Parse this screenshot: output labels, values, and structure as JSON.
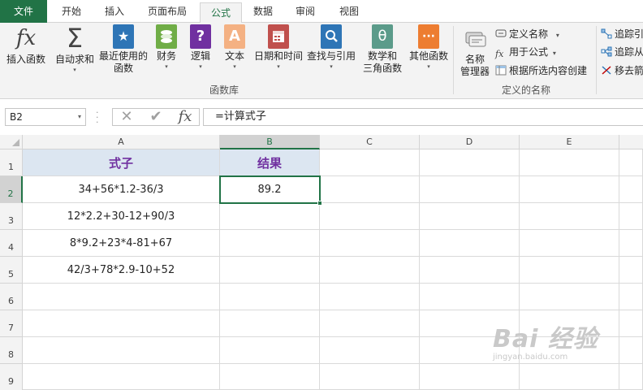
{
  "tabs": [
    "文件",
    "开始",
    "插入",
    "页面布局",
    "公式",
    "数据",
    "审阅",
    "视图"
  ],
  "active_tab": "公式",
  "ribbon": {
    "insert_function": "插入函数",
    "autosum": "自动求和",
    "recent_line1": "最近使用的",
    "recent_line2": "函数",
    "financial": "财务",
    "logical": "逻辑",
    "text": "文本",
    "datetime": "日期和时间",
    "lookup": "查找与引用",
    "math_line1": "数学和",
    "math_line2": "三角函数",
    "more": "其他函数",
    "function_library": "函数库",
    "name_manager_line1": "名称",
    "name_manager_line2": "管理器",
    "define_name": "定义名称",
    "use_in_formula": "用于公式",
    "create_from_selection": "根据所选内容创建",
    "defined_names": "定义的名称",
    "trace_precedents": "追踪引",
    "trace_dependents": "追踪从",
    "remove_arrows": "移去箭"
  },
  "icons": {
    "fx": "fx",
    "sigma": "Σ",
    "star": "★",
    "question": "?",
    "letter_a": "A",
    "theta": "θ",
    "more_dots": "···",
    "cancel": "✕",
    "confirm": "✔",
    "dropdown": "▾"
  },
  "colors": {
    "accent": "#217346",
    "header_fill": "#dce6f1",
    "header_text": "#7030a0"
  },
  "formula_bar": {
    "name_box": "B2",
    "formula": "=计算式子"
  },
  "columns": [
    "A",
    "B",
    "C",
    "D",
    "E"
  ],
  "rows": [
    "1",
    "2",
    "3",
    "4",
    "5",
    "6",
    "7",
    "8",
    "9"
  ],
  "cells": {
    "A1": "式子",
    "B1": "结果",
    "A2": "34+56*1.2-36/3",
    "B2": "89.2",
    "A3": "12*2.2+30-12+90/3",
    "A4": "8*9.2+23*4-81+67",
    "A5": "42/3+78*2.9-10+52"
  },
  "watermark": {
    "big": "Bai 经验",
    "small": "jingyan.baidu.com"
  }
}
